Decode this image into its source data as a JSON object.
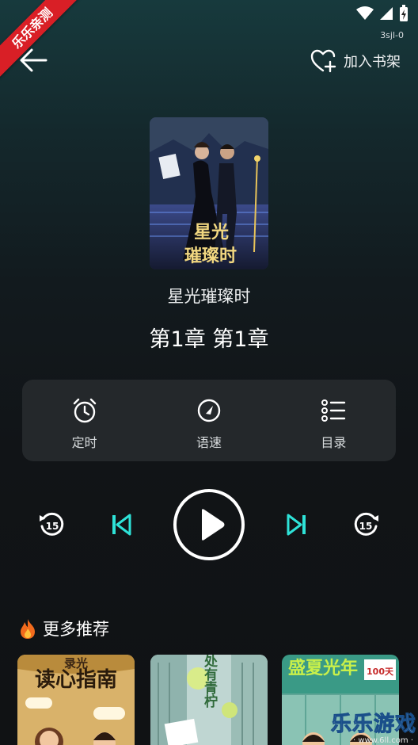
{
  "status_bar": {
    "device_id": "3sjl-0"
  },
  "ribbon": {
    "label": "乐乐亲测"
  },
  "header": {
    "add_to_shelf_label": "加入书架"
  },
  "book": {
    "title": "星光璀璨时",
    "cover_text": "星光\n璀璨时"
  },
  "chapter": {
    "title": "第1章  第1章"
  },
  "controls": {
    "timer_label": "定时",
    "speed_label": "语速",
    "toc_label": "目录"
  },
  "player": {
    "rewind_seconds": "15",
    "forward_seconds": "15"
  },
  "more": {
    "header_label": "更多推荐"
  },
  "recommendations": [
    {
      "title": "读心指南",
      "top_text": "录光"
    },
    {
      "title": "光深处有青柠"
    },
    {
      "title": "盛夏光年",
      "badge": "100天"
    }
  ],
  "watermark": {
    "text": "乐乐游戏",
    "url": "· www.6ll.com ·"
  },
  "colors": {
    "accent": "#2ee3d8",
    "panel": "#24282b",
    "background": "#111417"
  }
}
